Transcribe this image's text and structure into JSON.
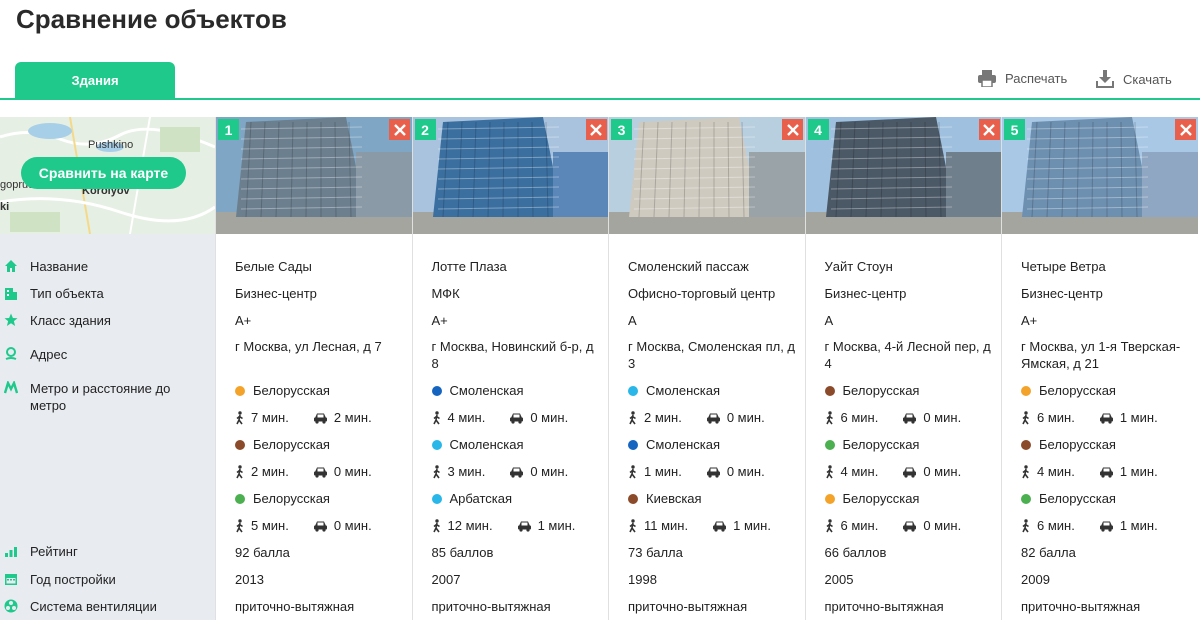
{
  "page": {
    "title": "Сравнение объектов"
  },
  "tabs": [
    {
      "label": "Здания"
    }
  ],
  "toolbar": {
    "print_label": "Распечать",
    "download_label": "Скачать"
  },
  "map": {
    "button_label": "Сравнить на карте",
    "labels": [
      "Pushkino",
      "Korolyov",
      "goprud",
      "ki"
    ]
  },
  "properties": [
    {
      "label": "Название",
      "icon": "home-icon"
    },
    {
      "label": "Тип объекта",
      "icon": "building-icon"
    },
    {
      "label": "Класс здания",
      "icon": "star-icon"
    },
    {
      "label": "Адрес",
      "icon": "location-pin-icon"
    },
    {
      "label": "Метро и расстояние до метро",
      "icon": "metro-icon"
    },
    {
      "label": "Рейтинг",
      "icon": "rating-bars-icon"
    },
    {
      "label": "Год постройки",
      "icon": "calendar-icon"
    },
    {
      "label": "Система вентиляции",
      "icon": "fan-icon"
    }
  ],
  "colors": {
    "accent": "#1fc98c",
    "close": "#e8604c"
  },
  "buildings": [
    {
      "num": "1",
      "name": "Белые Сады",
      "type": "Бизнес-центр",
      "class": "A+",
      "address": "г Москва, ул Лесная, д 7",
      "metro": [
        {
          "station": "Белорусская",
          "color": "#f3a32a",
          "walk": "7 мин.",
          "car": "2 мин."
        },
        {
          "station": "Белорусская",
          "color": "#8b4a2a",
          "walk": "2 мин.",
          "car": "0 мин."
        },
        {
          "station": "Белорусская",
          "color": "#4caf50",
          "walk": "5 мин.",
          "car": "0 мин."
        }
      ],
      "rating": "92 балла",
      "year": "2013",
      "ventilation": "приточно-вытяжная"
    },
    {
      "num": "2",
      "name": "Лотте Плаза",
      "type": "МФК",
      "class": "A+",
      "address": "г Москва, Новинский б-р, д 8",
      "metro": [
        {
          "station": "Смоленская",
          "color": "#1565c0",
          "walk": "4 мин.",
          "car": "0 мин."
        },
        {
          "station": "Смоленская",
          "color": "#29b6e8",
          "walk": "3 мин.",
          "car": "0 мин."
        },
        {
          "station": "Арбатская",
          "color": "#29b6e8",
          "walk": "12 мин.",
          "car": "1 мин."
        }
      ],
      "rating": "85 баллов",
      "year": "2007",
      "ventilation": "приточно-вытяжная"
    },
    {
      "num": "3",
      "name": "Смоленский пассаж",
      "type": "Офисно-торговый центр",
      "class": "A",
      "address": "г Москва, Смоленская пл, д 3",
      "metro": [
        {
          "station": "Смоленская",
          "color": "#29b6e8",
          "walk": "2 мин.",
          "car": "0 мин."
        },
        {
          "station": "Смоленская",
          "color": "#1565c0",
          "walk": "1 мин.",
          "car": "0 мин."
        },
        {
          "station": "Киевская",
          "color": "#8b4a2a",
          "walk": "11 мин.",
          "car": "1 мин."
        }
      ],
      "rating": "73 балла",
      "year": "1998",
      "ventilation": "приточно-вытяжная"
    },
    {
      "num": "4",
      "name": "Уайт Стоун",
      "type": "Бизнес-центр",
      "class": "A",
      "address": "г Москва, 4-й Лесной пер, д 4",
      "metro": [
        {
          "station": "Белорусская",
          "color": "#8b4a2a",
          "walk": "6 мин.",
          "car": "0 мин."
        },
        {
          "station": "Белорусская",
          "color": "#4caf50",
          "walk": "4 мин.",
          "car": "0 мин."
        },
        {
          "station": "Белорусская",
          "color": "#f3a32a",
          "walk": "6 мин.",
          "car": "0 мин."
        }
      ],
      "rating": "66 баллов",
      "year": "2005",
      "ventilation": "приточно-вытяжная"
    },
    {
      "num": "5",
      "name": "Четыре Ветра",
      "type": "Бизнес-центр",
      "class": "A+",
      "address": "г Москва, ул 1-я Тверская-Ямская, д 21",
      "metro": [
        {
          "station": "Белорусская",
          "color": "#f3a32a",
          "walk": "6 мин.",
          "car": "1 мин."
        },
        {
          "station": "Белорусская",
          "color": "#8b4a2a",
          "walk": "4 мин.",
          "car": "1 мин."
        },
        {
          "station": "Белорусская",
          "color": "#4caf50",
          "walk": "6 мин.",
          "car": "1 мин."
        }
      ],
      "rating": "82 балла",
      "year": "2009",
      "ventilation": "приточно-вытяжная"
    }
  ]
}
